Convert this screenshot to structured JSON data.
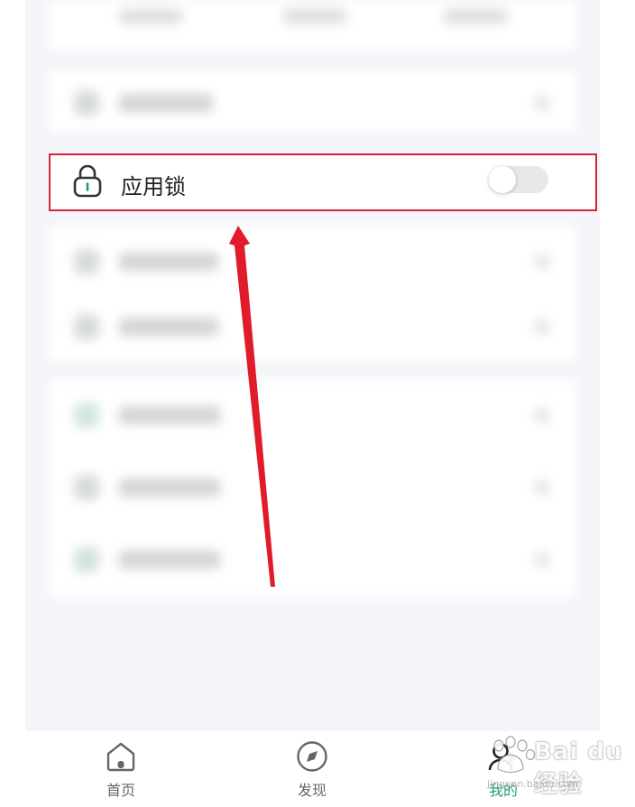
{
  "lock_row": {
    "label": "应用锁",
    "toggle_on": false
  },
  "tabbar": {
    "tabs": [
      {
        "label": "首页",
        "active": false
      },
      {
        "label": "发现",
        "active": false
      },
      {
        "label": "我的",
        "active": true
      }
    ]
  },
  "watermark": {
    "brand": "Bai du 经验",
    "url": "jingyan.baidu.com"
  },
  "colors": {
    "accent": "#1f9d6e",
    "highlight_border": "#d42436",
    "arrow": "#e01b2a"
  }
}
